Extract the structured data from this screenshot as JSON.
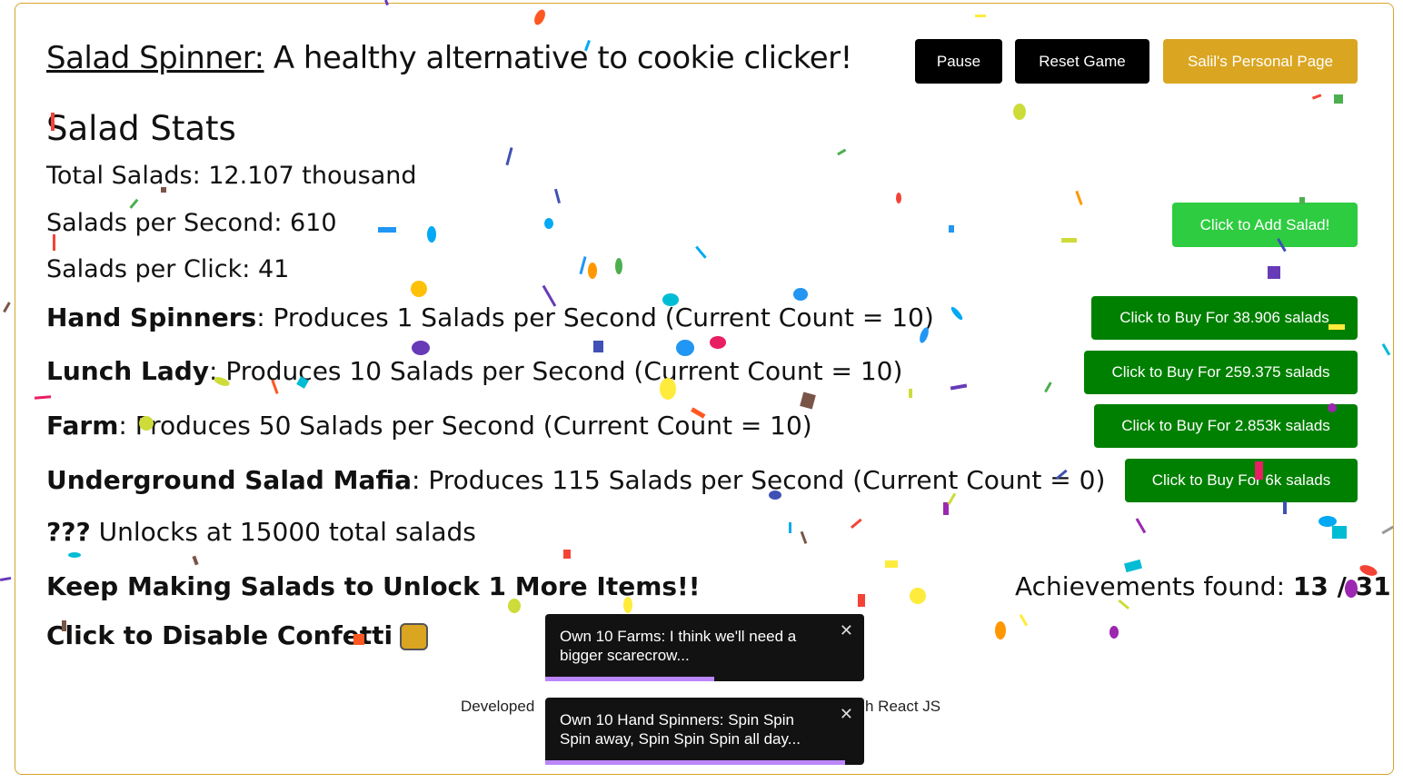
{
  "header": {
    "title_link": "Salad Spinner:",
    "title_rest": " A healthy alternative to cookie clicker!",
    "pause_label": "Pause",
    "reset_label": "Reset Game",
    "personal_label": "Salil's Personal Page"
  },
  "stats": {
    "heading": "Salad Stats",
    "total": "Total Salads: 12.107 thousand",
    "per_second": "Salads per Second: 610",
    "per_click": "Salads per Click: 41"
  },
  "add_button": "Click to Add Salad!",
  "items": [
    {
      "name": "Hand Spinners",
      "desc": ": Produces 1 Salads per Second (Current Count = 10)",
      "buy": "Click to Buy For 38.906 salads"
    },
    {
      "name": "Lunch Lady",
      "desc": ": Produces 10 Salads per Second (Current Count = 10)",
      "buy": "Click to Buy For 259.375 salads"
    },
    {
      "name": "Farm",
      "desc": ": Produces 50 Salads per Second (Current Count = 10)",
      "buy": "Click to Buy For 2.853k salads"
    },
    {
      "name": "Underground Salad Mafia",
      "desc": ": Produces 115 Salads per Second (Current Count = 0)",
      "buy": "Click to Buy For 6k salads"
    }
  ],
  "locked": {
    "name": "???",
    "desc": " Unlocks at 15000 total salads"
  },
  "keep_making": "Keep Making Salads to Unlock 1 More Items!!",
  "achievements": {
    "label": "Achievements found: ",
    "value": "13 / 31"
  },
  "confetti_toggle_label": "Click to Disable Confetti",
  "footer": {
    "left": "Developed",
    "right": "h React JS"
  },
  "toasts": [
    {
      "text": "Own 10 Farms: I think we'll need a bigger scarecrow...",
      "close": "✕",
      "progress": 0.53
    },
    {
      "text": "Own 10 Hand Spinners: Spin Spin Spin away, Spin Spin Spin all day...",
      "close": "✕",
      "progress": 0.94
    }
  ],
  "colors": {
    "accent": "#daa520",
    "green": "#2ecc40",
    "dark_green": "#008000",
    "toast_bar": "#bb86fc"
  }
}
